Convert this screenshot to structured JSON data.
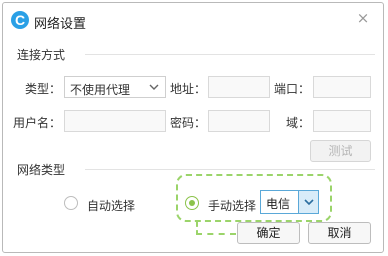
{
  "window": {
    "title": "网络设置",
    "icon_letter": "C",
    "icon": "app-logo-icon",
    "close_icon": "close-icon",
    "close_glyph": "×"
  },
  "proxy_section": {
    "title": "连接方式",
    "type_label": "类型：",
    "type_value": "不使用代理",
    "address_label": "地址：",
    "address_value": "",
    "port_label": "端口：",
    "port_value": "",
    "username_label": "用户名：",
    "username_value": "",
    "password_label": "密码：",
    "password_value": "",
    "domain_label": "域：",
    "domain_value": "",
    "test_button": "测试"
  },
  "network_section": {
    "title": "网络类型",
    "auto_label": "自动选择",
    "manual_label": "手动选择",
    "selected": "manual",
    "carrier_value": "电信"
  },
  "footer": {
    "ok_button": "确定",
    "cancel_button": "取消"
  },
  "colors": {
    "accent_green": "#8bc34a",
    "select_blue": "#5aa8d8",
    "icon_blue": "#2aa0e6"
  }
}
